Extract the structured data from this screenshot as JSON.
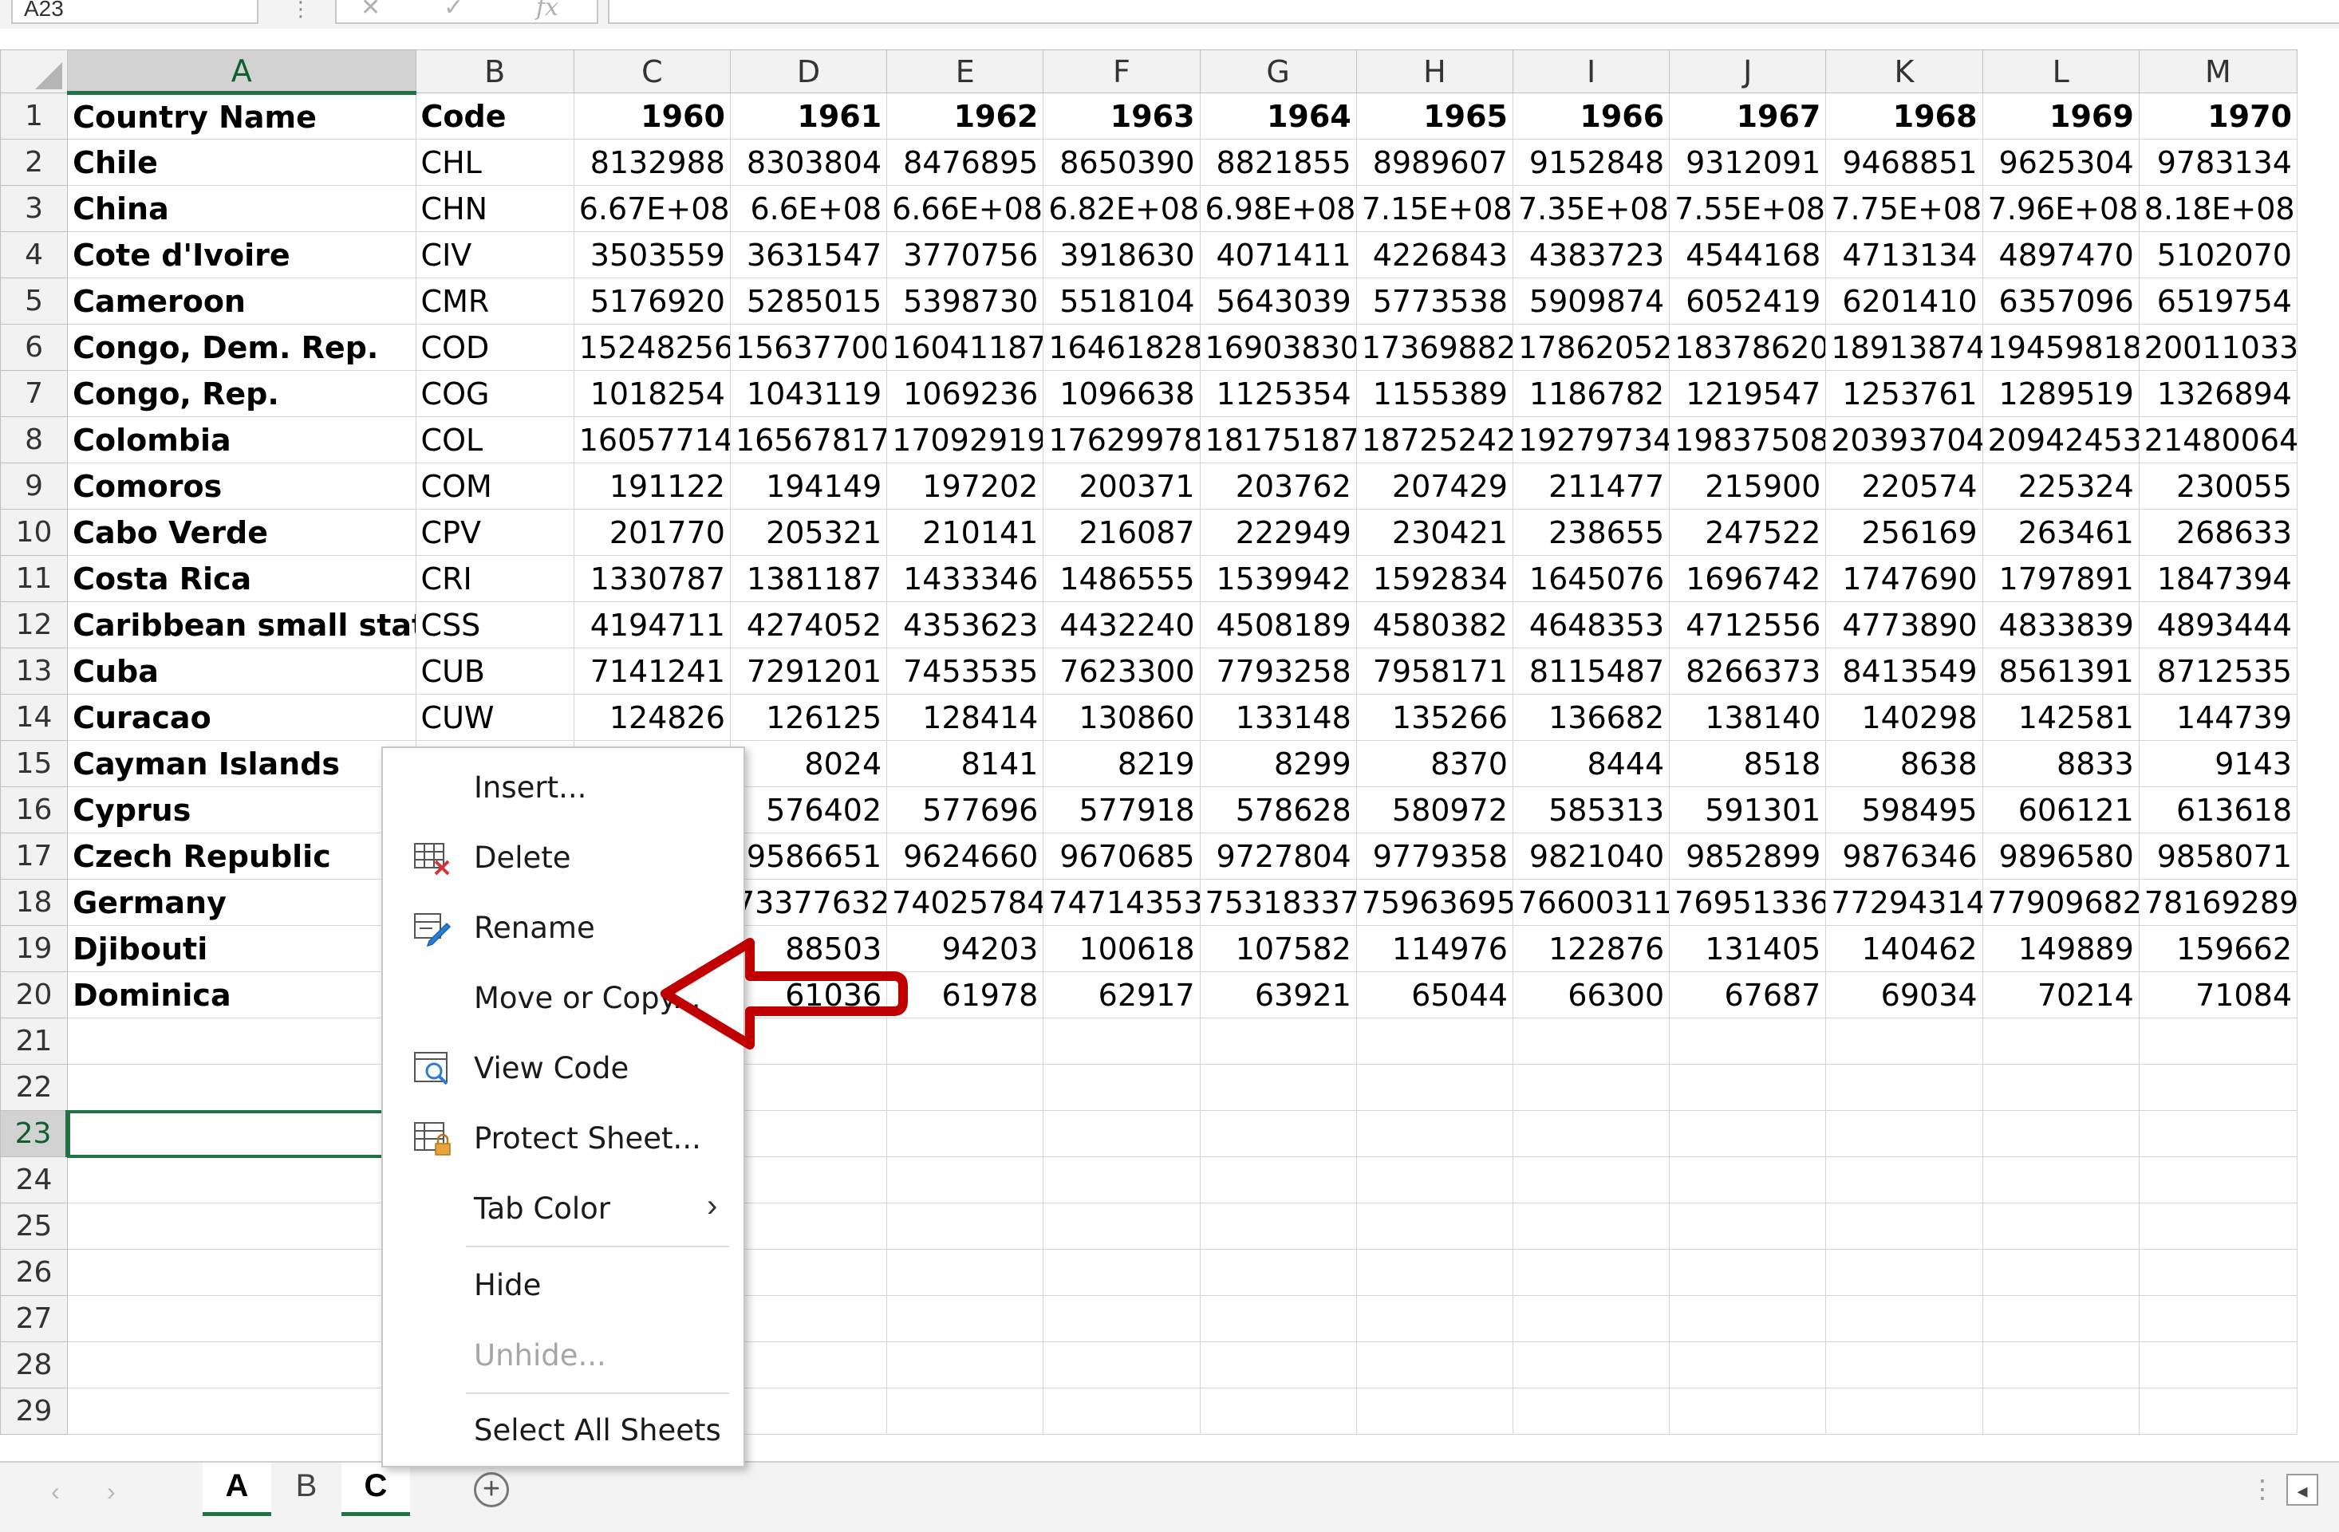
{
  "name_box": "A23",
  "formula_bar": {
    "fx_label": "fx",
    "cancel": "✕",
    "enter": "✓",
    "content": ""
  },
  "columns": [
    "A",
    "B",
    "C",
    "D",
    "E",
    "F",
    "G",
    "H",
    "I",
    "J",
    "K",
    "L",
    "M"
  ],
  "selected_column": "A",
  "selected_row": 23,
  "header_row": [
    "Country Name",
    "Code",
    "1960",
    "1961",
    "1962",
    "1963",
    "1964",
    "1965",
    "1966",
    "1967",
    "1968",
    "1969",
    "1970"
  ],
  "rows": [
    [
      "Chile",
      "CHL",
      "8132988",
      "8303804",
      "8476895",
      "8650390",
      "8821855",
      "8989607",
      "9152848",
      "9312091",
      "9468851",
      "9625304",
      "9783134"
    ],
    [
      "China",
      "CHN",
      "6.67E+08",
      "6.6E+08",
      "6.66E+08",
      "6.82E+08",
      "6.98E+08",
      "7.15E+08",
      "7.35E+08",
      "7.55E+08",
      "7.75E+08",
      "7.96E+08",
      "8.18E+08"
    ],
    [
      "Cote d'Ivoire",
      "CIV",
      "3503559",
      "3631547",
      "3770756",
      "3918630",
      "4071411",
      "4226843",
      "4383723",
      "4544168",
      "4713134",
      "4897470",
      "5102070"
    ],
    [
      "Cameroon",
      "CMR",
      "5176920",
      "5285015",
      "5398730",
      "5518104",
      "5643039",
      "5773538",
      "5909874",
      "6052419",
      "6201410",
      "6357096",
      "6519754"
    ],
    [
      "Congo, Dem. Rep.",
      "COD",
      "15248256",
      "15637700",
      "16041187",
      "16461828",
      "16903830",
      "17369882",
      "17862052",
      "18378620",
      "18913874",
      "19459818",
      "20011033"
    ],
    [
      "Congo, Rep.",
      "COG",
      "1018254",
      "1043119",
      "1069236",
      "1096638",
      "1125354",
      "1155389",
      "1186782",
      "1219547",
      "1253761",
      "1289519",
      "1326894"
    ],
    [
      "Colombia",
      "COL",
      "16057714",
      "16567817",
      "17092919",
      "17629978",
      "18175187",
      "18725242",
      "19279734",
      "19837508",
      "20393704",
      "20942453",
      "21480064"
    ],
    [
      "Comoros",
      "COM",
      "191122",
      "194149",
      "197202",
      "200371",
      "203762",
      "207429",
      "211477",
      "215900",
      "220574",
      "225324",
      "230055"
    ],
    [
      "Cabo Verde",
      "CPV",
      "201770",
      "205321",
      "210141",
      "216087",
      "222949",
      "230421",
      "238655",
      "247522",
      "256169",
      "263461",
      "268633"
    ],
    [
      "Costa Rica",
      "CRI",
      "1330787",
      "1381187",
      "1433346",
      "1486555",
      "1539942",
      "1592834",
      "1645076",
      "1696742",
      "1747690",
      "1797891",
      "1847394"
    ],
    [
      "Caribbean small states",
      "CSS",
      "4194711",
      "4274052",
      "4353623",
      "4432240",
      "4508189",
      "4580382",
      "4648353",
      "4712556",
      "4773890",
      "4833839",
      "4893444"
    ],
    [
      "Cuba",
      "CUB",
      "7141241",
      "7291201",
      "7453535",
      "7623300",
      "7793258",
      "7958171",
      "8115487",
      "8266373",
      "8413549",
      "8561391",
      "8712535"
    ],
    [
      "Curacao",
      "CUW",
      "124826",
      "126125",
      "128414",
      "130860",
      "133148",
      "135266",
      "136682",
      "138140",
      "140298",
      "142581",
      "144739"
    ],
    [
      "Cayman Islands",
      "",
      "",
      "8024",
      "8141",
      "8219",
      "8299",
      "8370",
      "8444",
      "8518",
      "8638",
      "8833",
      "9143"
    ],
    [
      "Cyprus",
      "",
      "",
      "576402",
      "577696",
      "577918",
      "578628",
      "580972",
      "585313",
      "591301",
      "598495",
      "606121",
      "613618"
    ],
    [
      "Czech Republic",
      "",
      "",
      "9586651",
      "9624660",
      "9670685",
      "9727804",
      "9779358",
      "9821040",
      "9852899",
      "9876346",
      "9896580",
      "9858071"
    ],
    [
      "Germany",
      "",
      "",
      "73377632",
      "74025784",
      "74714353",
      "75318337",
      "75963695",
      "76600311",
      "76951336",
      "77294314",
      "77909682",
      "78169289"
    ],
    [
      "Djibouti",
      "",
      "",
      "88503",
      "94203",
      "100618",
      "107582",
      "114976",
      "122876",
      "131405",
      "140462",
      "149889",
      "159662"
    ],
    [
      "Dominica",
      "",
      "",
      "61036",
      "61978",
      "62917",
      "63921",
      "65044",
      "66300",
      "67687",
      "69034",
      "70214",
      "71084"
    ],
    [
      "",
      "",
      "",
      "",
      "",
      "",
      "",
      "",
      "",
      "",
      "",
      "",
      ""
    ],
    [
      "",
      "",
      "",
      "",
      "",
      "",
      "",
      "",
      "",
      "",
      "",
      "",
      ""
    ],
    [
      "",
      "",
      "",
      "",
      "",
      "",
      "",
      "",
      "",
      "",
      "",
      "",
      ""
    ],
    [
      "",
      "",
      "",
      "",
      "",
      "",
      "",
      "",
      "",
      "",
      "",
      "",
      ""
    ],
    [
      "",
      "",
      "",
      "",
      "",
      "",
      "",
      "",
      "",
      "",
      "",
      "",
      ""
    ],
    [
      "",
      "",
      "",
      "",
      "",
      "",
      "",
      "",
      "",
      "",
      "",
      "",
      ""
    ],
    [
      "",
      "",
      "",
      "",
      "",
      "",
      "",
      "",
      "",
      "",
      "",
      "",
      ""
    ],
    [
      "",
      "",
      "",
      "",
      "",
      "",
      "",
      "",
      "",
      "",
      "",
      "",
      ""
    ],
    [
      "",
      "",
      "",
      "",
      "",
      "",
      "",
      "",
      "",
      "",
      "",
      "",
      ""
    ]
  ],
  "sheet_tabs": [
    {
      "label": "A",
      "active": true
    },
    {
      "label": "B",
      "active": false
    },
    {
      "label": "C",
      "active": false
    }
  ],
  "context_menu": {
    "items": [
      {
        "label": "Insert...",
        "icon": "",
        "enabled": true
      },
      {
        "label": "Delete",
        "icon": "delete-sheet-icon",
        "enabled": true
      },
      {
        "label": "Rename",
        "icon": "rename-sheet-icon",
        "enabled": true
      },
      {
        "label": "Move or Copy...",
        "icon": "",
        "enabled": true
      },
      {
        "label": "View Code",
        "icon": "view-code-icon",
        "enabled": true
      },
      {
        "label": "Protect Sheet...",
        "icon": "protect-sheet-icon",
        "enabled": true
      },
      {
        "label": "Tab Color",
        "icon": "",
        "enabled": true,
        "submenu": true
      },
      {
        "label": "Hide",
        "icon": "",
        "enabled": true
      },
      {
        "label": "Unhide...",
        "icon": "",
        "enabled": false
      },
      {
        "label": "Select All Sheets",
        "icon": "",
        "enabled": true
      }
    ]
  },
  "colors": {
    "accent_green": "#217346",
    "annotation_red": "#c00000",
    "header_bg": "#f2f2f2"
  }
}
